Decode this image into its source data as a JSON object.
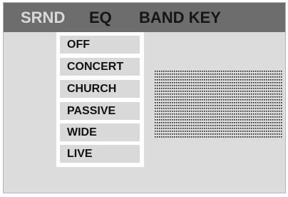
{
  "tabs": [
    {
      "label": "SRND",
      "active": true
    },
    {
      "label": "EQ",
      "active": false
    },
    {
      "label": "BAND KEY",
      "active": false
    }
  ],
  "surround_menu": {
    "options": [
      "OFF",
      "CONCERT",
      "CHURCH",
      "PASSIVE",
      "WIDE",
      "LIVE"
    ]
  },
  "colors": {
    "screen_bg": "#dcdcdc",
    "tab_bar_bg": "#6d6d6d",
    "active_tab_text": "#d9d9d9",
    "tab_text": "#161616",
    "menu_bg": "#ffffff",
    "menu_item_bg": "#d9d9d9"
  }
}
